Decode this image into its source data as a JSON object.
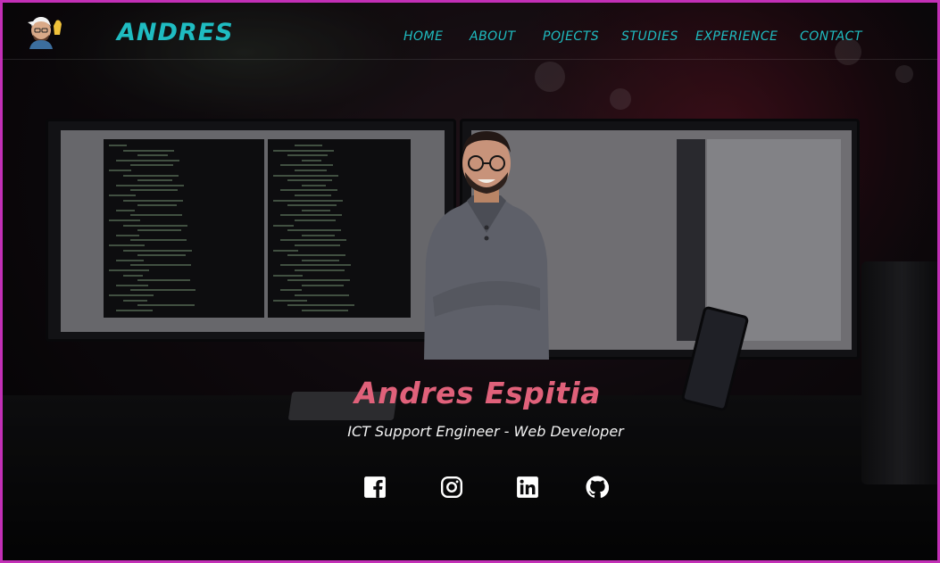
{
  "header": {
    "brand": "ANDRES",
    "nav": [
      {
        "id": "home",
        "label": "HOME"
      },
      {
        "id": "about",
        "label": "ABOUT"
      },
      {
        "id": "projects",
        "label": "POJECTS"
      },
      {
        "id": "studies",
        "label": "STUDIES"
      },
      {
        "id": "experience",
        "label": "EXPERIENCE"
      },
      {
        "id": "contact",
        "label": "CONTACT"
      }
    ]
  },
  "hero": {
    "name": "Andres Espitia",
    "subtitle": "ICT Support Engineer - Web Developer"
  },
  "social": [
    {
      "id": "facebook",
      "icon": "facebook-icon"
    },
    {
      "id": "instagram",
      "icon": "instagram-icon"
    },
    {
      "id": "linkedin",
      "icon": "linkedin-icon"
    },
    {
      "id": "github",
      "icon": "github-icon"
    }
  ],
  "colors": {
    "accent": "#1fbcc1",
    "name": "#e0617a",
    "frame": "#c22fb6",
    "text": "#f2f2f2"
  }
}
